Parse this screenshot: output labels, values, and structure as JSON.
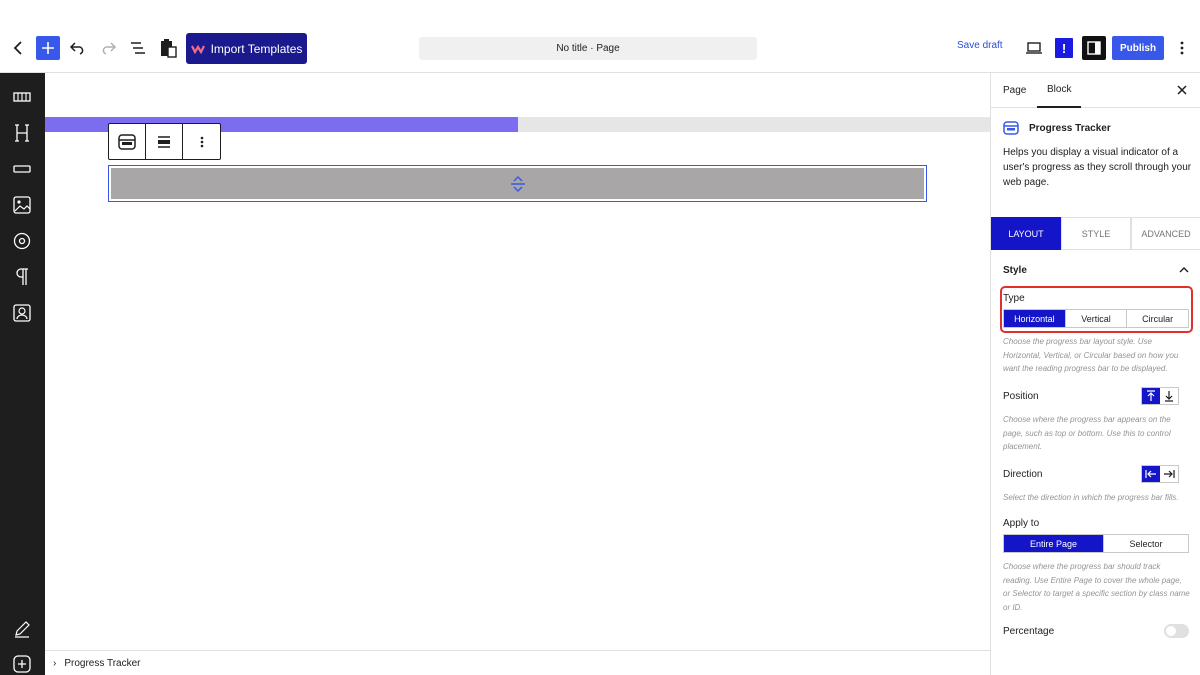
{
  "topbar": {
    "import_label": "Import Templates",
    "doc_title": "No title · Page",
    "save_draft": "Save draft",
    "notice_glyph": "!",
    "publish": "Publish",
    "icons": [
      "chevron-left-icon",
      "plus-icon",
      "undo-icon",
      "redo-icon",
      "list-view-icon",
      "clipboard-icon",
      "desktop-icon",
      "settings-icon",
      "more-vertical-icon"
    ]
  },
  "sidebar_icons": [
    "block-grid-icon",
    "heading-icon",
    "button-icon",
    "image-icon",
    "circle-icon",
    "paragraph-icon",
    "user-box-icon",
    "edit-pencil-icon",
    "add-circle-icon"
  ],
  "canvas": {
    "progress_fraction": 0.5
  },
  "breadcrumb": {
    "arrow": "›",
    "label": "Progress Tracker"
  },
  "panel": {
    "tabs": [
      "Page",
      "Block"
    ],
    "active_tab": "Block",
    "block_name": "Progress Tracker",
    "block_description": "Helps you display a visual indicator of a user's progress as they scroll through your web page.",
    "segments": [
      "LAYOUT",
      "STYLE",
      "ADVANCED"
    ],
    "active_segment": "LAYOUT",
    "section_title": "Style",
    "type": {
      "label": "Type",
      "options": [
        "Horizontal",
        "Vertical",
        "Circular"
      ],
      "selected": "Horizontal",
      "help": "Choose the progress bar layout style. Use Horizontal, Vertical, or Circular based on how you want the reading progress bar to be displayed."
    },
    "position": {
      "label": "Position",
      "selected": "top",
      "help": "Choose where the progress bar appears on the page, such as top or bottom. Use this to control placement."
    },
    "direction": {
      "label": "Direction",
      "selected": "left-to-right",
      "help": "Select the direction in which the progress bar fills."
    },
    "apply_to": {
      "label": "Apply to",
      "options": [
        "Entire Page",
        "Selector"
      ],
      "selected": "Entire Page",
      "help": "Choose where the progress bar should track reading. Use Entire Page to cover the whole page, or Selector to target a specific section by class name or ID."
    },
    "percentage": {
      "label": "Percentage",
      "enabled": false
    }
  },
  "colors": {
    "accent": "#3858e9",
    "active": "#1414c8",
    "progress": "#7b6cf0",
    "highlight": "#e0302a"
  }
}
